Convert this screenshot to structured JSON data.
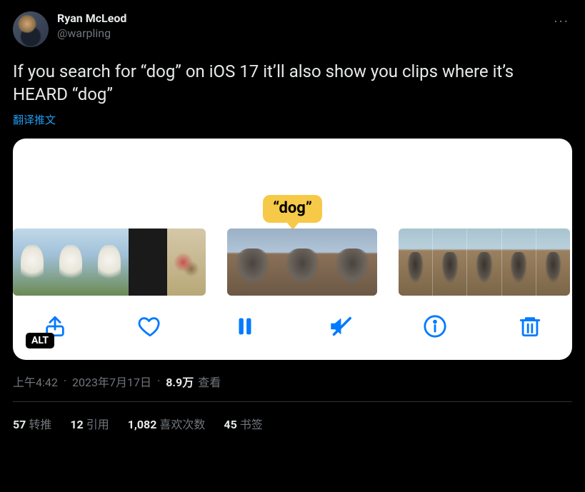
{
  "tweet": {
    "author": {
      "display_name": "Ryan McLeod",
      "handle": "@warpling"
    },
    "body": "If you search for “dog” on iOS 17 it’ll also show you clips where it’s HEARD “dog”",
    "translate_label": "翻译推文",
    "more_glyph": "···"
  },
  "media": {
    "caption": "“dog”",
    "alt_label": "ALT",
    "toolbar": {
      "share": "share",
      "like": "like",
      "pause": "pause",
      "mute": "mute",
      "info": "info",
      "trash": "trash"
    }
  },
  "meta": {
    "time": "上午4:42",
    "date": "2023年7月17日",
    "views_count": "8.9万",
    "views_label": "查看"
  },
  "stats": {
    "retweets": {
      "count": "57",
      "label": "转推"
    },
    "quotes": {
      "count": "12",
      "label": "引用"
    },
    "likes": {
      "count": "1,082",
      "label": "喜欢次数"
    },
    "bookmarks": {
      "count": "45",
      "label": "书签"
    }
  }
}
